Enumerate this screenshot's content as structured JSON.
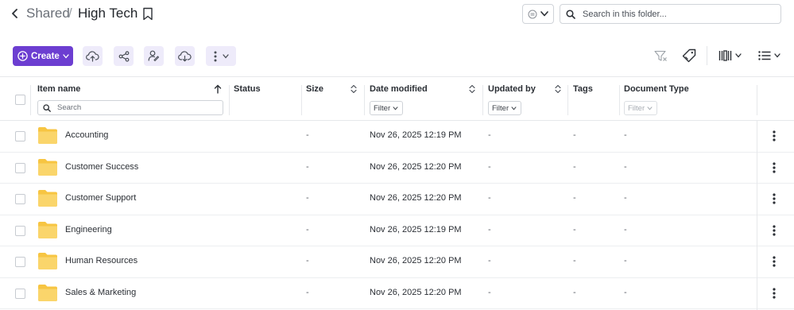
{
  "breadcrumb": {
    "root": "Shared",
    "separator": "/",
    "current": "High Tech"
  },
  "search": {
    "placeholder": "Search in this folder...",
    "value": ""
  },
  "toolbar": {
    "create_label": "Create",
    "accent_color": "#6c3ed1",
    "icons": [
      "upload-icon",
      "share-icon",
      "assign-user-icon",
      "download-icon",
      "more-vertical-icon"
    ],
    "right_icons": [
      "clear-filter-icon",
      "tag-icon",
      "columns-icon",
      "list-view-icon"
    ]
  },
  "table": {
    "columns": {
      "name": "Item name",
      "status": "Status",
      "size": "Size",
      "date": "Date modified",
      "updated_by": "Updated by",
      "tags": "Tags",
      "doc_type": "Document Type"
    },
    "name_search_placeholder": "Search",
    "filter_label": "Filter",
    "rows": [
      {
        "name": "Accounting",
        "size": "-",
        "date": "Nov 26, 2025 12:19 PM",
        "updated_by": "-",
        "tags": "-",
        "doc_type": "-"
      },
      {
        "name": "Customer Success",
        "size": "-",
        "date": "Nov 26, 2025 12:20 PM",
        "updated_by": "-",
        "tags": "-",
        "doc_type": "-"
      },
      {
        "name": "Customer Support",
        "size": "-",
        "date": "Nov 26, 2025 12:20 PM",
        "updated_by": "-",
        "tags": "-",
        "doc_type": "-"
      },
      {
        "name": "Engineering",
        "size": "-",
        "date": "Nov 26, 2025 12:19 PM",
        "updated_by": "-",
        "tags": "-",
        "doc_type": "-"
      },
      {
        "name": "Human Resources",
        "size": "-",
        "date": "Nov 26, 2025 12:20 PM",
        "updated_by": "-",
        "tags": "-",
        "doc_type": "-"
      },
      {
        "name": "Sales & Marketing",
        "size": "-",
        "date": "Nov 26, 2025 12:20 PM",
        "updated_by": "-",
        "tags": "-",
        "doc_type": "-"
      }
    ]
  }
}
